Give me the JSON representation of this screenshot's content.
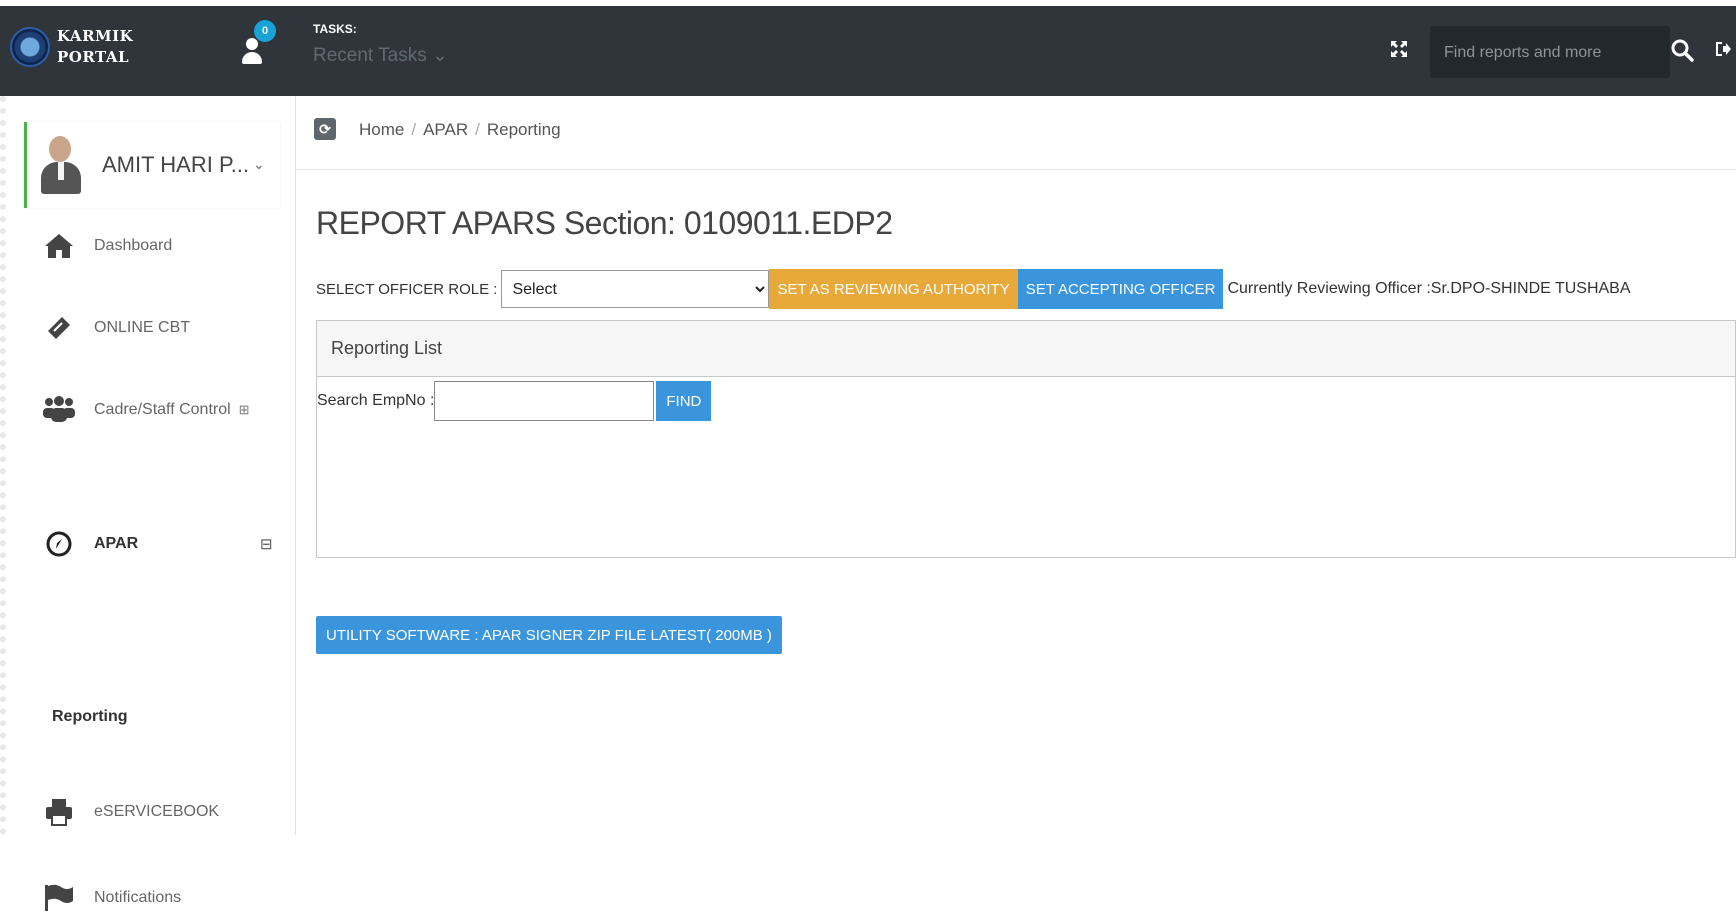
{
  "header": {
    "brand_line1": "KARMIK",
    "brand_line2": "PORTAL",
    "user_badge": "0",
    "tasks_label": "TASKS:",
    "tasks_recent": "Recent Tasks ⌄",
    "search_placeholder": "Find reports and more"
  },
  "profile": {
    "name": "AMIT HARI P...",
    "chevron": "⌄"
  },
  "sidebar": {
    "items": [
      {
        "label": "Dashboard",
        "icon": "home-icon"
      },
      {
        "label": "ONLINE CBT",
        "icon": "ticket-icon"
      },
      {
        "label": "Cadre/Staff Control",
        "icon": "users-icon",
        "toggle": "⊞"
      },
      {
        "label": "APAR",
        "icon": "compass-icon",
        "toggle": "⊟"
      },
      {
        "label": "eSERVICEBOOK",
        "icon": "printer-icon"
      },
      {
        "label": "Notifications",
        "icon": "flag-icon"
      }
    ],
    "sub_item": "Reporting"
  },
  "breadcrumb": {
    "home": "Home",
    "section": "APAR",
    "page": "Reporting",
    "separator": "/"
  },
  "main": {
    "title": "REPORT APARS Section: 0109011.EDP2",
    "role_label": "SELECT OFFICER ROLE :",
    "role_select_value": "Select",
    "btn_reviewing": "SET AS REVIEWING AUTHORITY",
    "btn_accepting": "SET ACCEPTING OFFICER",
    "reviewing_text": "Currently Reviewing Officer :Sr.DPO-SHINDE TUSHABA",
    "panel_title": "Reporting List",
    "search_label": "Search EmpNo :",
    "search_value": "",
    "btn_find": "FIND",
    "btn_utility": "UTILITY SOFTWARE : APAR SIGNER ZIP FILE LATEST( 200MB )"
  },
  "colors": {
    "topbar": "#2f353a",
    "orange_button": "#e6a93a",
    "blue_button": "#3a95dd",
    "badge": "#17a2d8",
    "profile_accent": "#4caf50"
  }
}
